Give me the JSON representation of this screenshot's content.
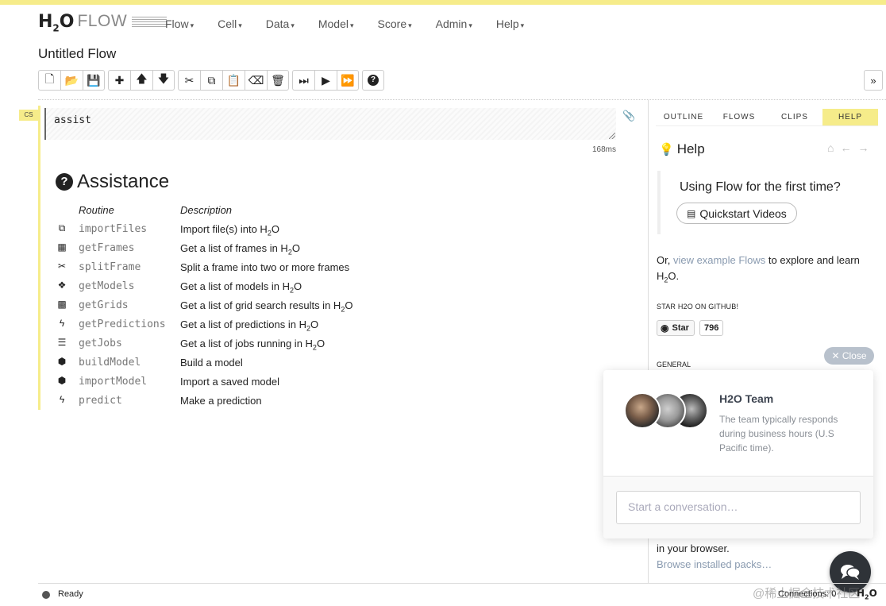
{
  "app": {
    "logo_main": "H",
    "logo_sub": "2",
    "logo_tail": "O",
    "logo_flow": "FLOW"
  },
  "menu": [
    {
      "label": "Flow",
      "caret": "▾"
    },
    {
      "label": "Cell",
      "caret": "▾"
    },
    {
      "label": "Data",
      "caret": "▾"
    },
    {
      "label": "Model",
      "caret": "▾"
    },
    {
      "label": "Score",
      "caret": "▾"
    },
    {
      "label": "Admin",
      "caret": "▾"
    },
    {
      "label": "Help",
      "caret": "▾"
    }
  ],
  "flow_title": "Untitled Flow",
  "toolbar": {
    "new_icon": "🗋",
    "open_icon": "📂",
    "save_icon": "💾",
    "insert_icon": "✚",
    "up_icon": "🡅",
    "down_icon": "🡇",
    "cut_icon": "✂",
    "copy_icon": "⧉",
    "paste_icon": "📋",
    "clear_icon": "⌫",
    "delete_icon": "🗑",
    "step_icon": "⏭",
    "run_icon": "▶",
    "runall_icon": "⏩",
    "help_icon": "?",
    "expand_icon": "»"
  },
  "cell": {
    "type": "CS",
    "input": "assist",
    "timing": "168ms",
    "clip_icon": "📎"
  },
  "assistance": {
    "title": "Assistance",
    "q_icon": "?",
    "col_routine": "Routine",
    "col_description": "Description",
    "rows": [
      {
        "icon": "⧉",
        "routine": "importFiles",
        "desc_a": "Import file(s) into H",
        "desc_sub": "2",
        "desc_b": "O"
      },
      {
        "icon": "▦",
        "routine": "getFrames",
        "desc_a": "Get a list of frames in H",
        "desc_sub": "2",
        "desc_b": "O"
      },
      {
        "icon": "✂",
        "routine": "splitFrame",
        "desc_a": "Split a frame into two or more frames",
        "desc_sub": "",
        "desc_b": ""
      },
      {
        "icon": "❖",
        "routine": "getModels",
        "desc_a": "Get a list of models in H",
        "desc_sub": "2",
        "desc_b": "O"
      },
      {
        "icon": "▩",
        "routine": "getGrids",
        "desc_a": "Get a list of grid search results in H",
        "desc_sub": "2",
        "desc_b": "O"
      },
      {
        "icon": "ϟ",
        "routine": "getPredictions",
        "desc_a": "Get a list of predictions in H",
        "desc_sub": "2",
        "desc_b": "O"
      },
      {
        "icon": "☰",
        "routine": "getJobs",
        "desc_a": "Get a list of jobs running in H",
        "desc_sub": "2",
        "desc_b": "O"
      },
      {
        "icon": "⬢",
        "routine": "buildModel",
        "desc_a": "Build a model",
        "desc_sub": "",
        "desc_b": ""
      },
      {
        "icon": "⬢",
        "routine": "importModel",
        "desc_a": "Import a saved model",
        "desc_sub": "",
        "desc_b": ""
      },
      {
        "icon": "ϟ",
        "routine": "predict",
        "desc_a": "Make a prediction",
        "desc_sub": "",
        "desc_b": ""
      }
    ]
  },
  "right_tabs": [
    {
      "label": "OUTLINE",
      "active": false
    },
    {
      "label": "FLOWS",
      "active": false
    },
    {
      "label": "CLIPS",
      "active": false
    },
    {
      "label": "HELP",
      "active": true
    }
  ],
  "help": {
    "title": "Help",
    "bulb_icon": "💡",
    "home_icon": "⌂",
    "back_icon": "←",
    "forward_icon": "→",
    "first_time": "Using Flow for the first time?",
    "quickstart": "Quickstart Videos",
    "quickstart_icon": "▤",
    "or_text": "Or, ",
    "view_link": "view example Flows",
    "explore_a": " to explore and learn H",
    "explore_sub": "2",
    "explore_b": "O.",
    "star_label": "STAR H2O ON GITHUB!",
    "star_btn": "Star",
    "star_count": "796",
    "github_icon": "◉",
    "general_label": "GENERAL",
    "in_browser": "in your browser.",
    "browse_packs": "Browse installed packs…"
  },
  "chat": {
    "close_label": "✕ Close",
    "team_name": "H2O Team",
    "team_desc": "The team typically responds during business hours (U.S Pacific time).",
    "input_placeholder": "Start a conversation…"
  },
  "status": {
    "state": "Ready",
    "connections": "Connections: 0",
    "logo_h": "H",
    "logo_sub": "2",
    "logo_o": "O",
    "watermark": "@稀土掘金技术社区"
  },
  "colors": {
    "accent_yellow": "#f6ec8a",
    "link_gray_blue": "#8a9bb0",
    "chat_dark": "#2f3338"
  }
}
